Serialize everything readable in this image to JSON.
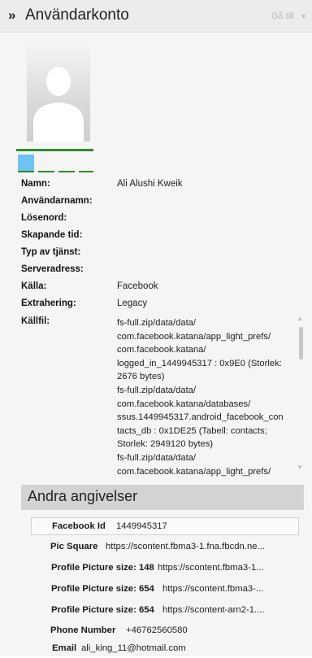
{
  "header": {
    "chevron": "»",
    "title": "Användarkonto",
    "goto_label": "Gå till",
    "goto_caret": "▾"
  },
  "icons": {
    "avatar": "person-silhouette-icon",
    "scroll_up": "triangle-up-icon",
    "scroll_down": "triangle-down-icon"
  },
  "colors": {
    "accent_green": "#2e8b2e",
    "thumb_blue": "#6ec3ef",
    "section_bg": "#d3d3d3"
  },
  "fields": [
    {
      "label": "Namn:",
      "value": "Ali Alushi Kweik"
    },
    {
      "label": "Användarnamn:",
      "value": ""
    },
    {
      "label": "Lösenord:",
      "value": ""
    },
    {
      "label": "Skapande tid:",
      "value": ""
    },
    {
      "label": "Typ av tjänst:",
      "value": ""
    },
    {
      "label": "Serveradress:",
      "value": ""
    },
    {
      "label": "Källa:",
      "value": "Facebook"
    },
    {
      "label": "Extrahering:",
      "value": "Legacy"
    }
  ],
  "source": {
    "label": "Källfil:",
    "lines": [
      "fs-full.zip/data/data/",
      "com.facebook.katana/app_light_prefs/",
      "com.facebook.katana/",
      "logged_in_1449945317 : 0x9E0 (Storlek:",
      "2676 bytes)",
      "fs-full.zip/data/data/",
      "com.facebook.katana/databases/",
      "ssus.1449945317.android_facebook_con",
      "tacts_db : 0x1DE25 (Tabell: contacts;",
      "Storlek: 2949120 bytes)",
      "fs-full.zip/data/data/",
      "com.facebook.katana/app_light_prefs/"
    ]
  },
  "other": {
    "title": "Andra angivelser",
    "rows": [
      {
        "key": "Facebook Id",
        "value": "1449945317"
      },
      {
        "key": "Pic Square",
        "value": "https://scontent.fbma3-1.fna.fbcdn.ne..."
      },
      {
        "key": "Profile Picture size: 148",
        "value": "https://scontent.fbma3-1..."
      },
      {
        "key": "Profile Picture size: 654",
        "value": "https://scontent.fbma3-..."
      },
      {
        "key": "Profile Picture size: 654",
        "value": "https://scontent-arn2-1...."
      },
      {
        "key": "Phone Number",
        "value": "+46762560580"
      },
      {
        "key": "Email",
        "value": "ali_king_11@hotmail.com"
      }
    ]
  }
}
